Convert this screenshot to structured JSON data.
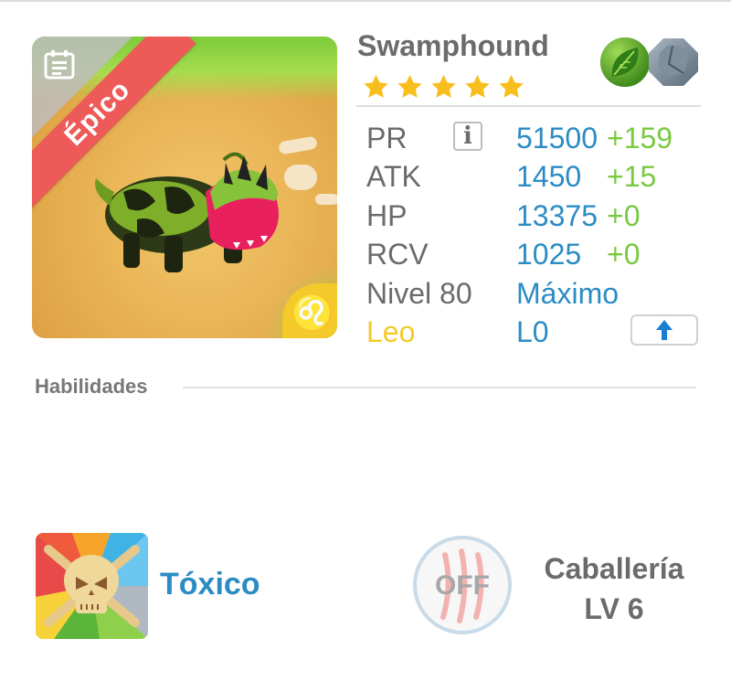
{
  "monster": {
    "name": "Swamphound",
    "rarity": "Épico",
    "star_count": 5,
    "elements": [
      "leaf-icon",
      "stone-icon"
    ],
    "sign_symbol": "♌"
  },
  "stats": [
    {
      "label": "PR",
      "value": "51500",
      "bonus": "+159"
    },
    {
      "label": "ATK",
      "value": "1450",
      "bonus": "+15"
    },
    {
      "label": "HP",
      "value": "13375",
      "bonus": "+0"
    },
    {
      "label": "RCV",
      "value": "1025",
      "bonus": "+0"
    },
    {
      "label": "Nivel 80",
      "value": "Máximo",
      "bonus": ""
    },
    {
      "label": "Leo",
      "value": "L0",
      "bonus": ""
    }
  ],
  "info_label": "i",
  "section": {
    "title": "Habilidades"
  },
  "skills": {
    "active": {
      "name": "Tóxico",
      "icon": "skull-crossbones-icon"
    },
    "passive": {
      "state": "OFF",
      "name": "Caballería",
      "level": "LV 6",
      "icon": "claw-scratch-icon"
    }
  },
  "colors": {
    "accent_blue": "#2b8cc4",
    "bonus_green": "#7ac943",
    "star_gold": "#f7be1e",
    "sign_gold": "#f4c92a",
    "rarity_red": "#ee5a57",
    "text_gray": "#6b6b6b"
  }
}
